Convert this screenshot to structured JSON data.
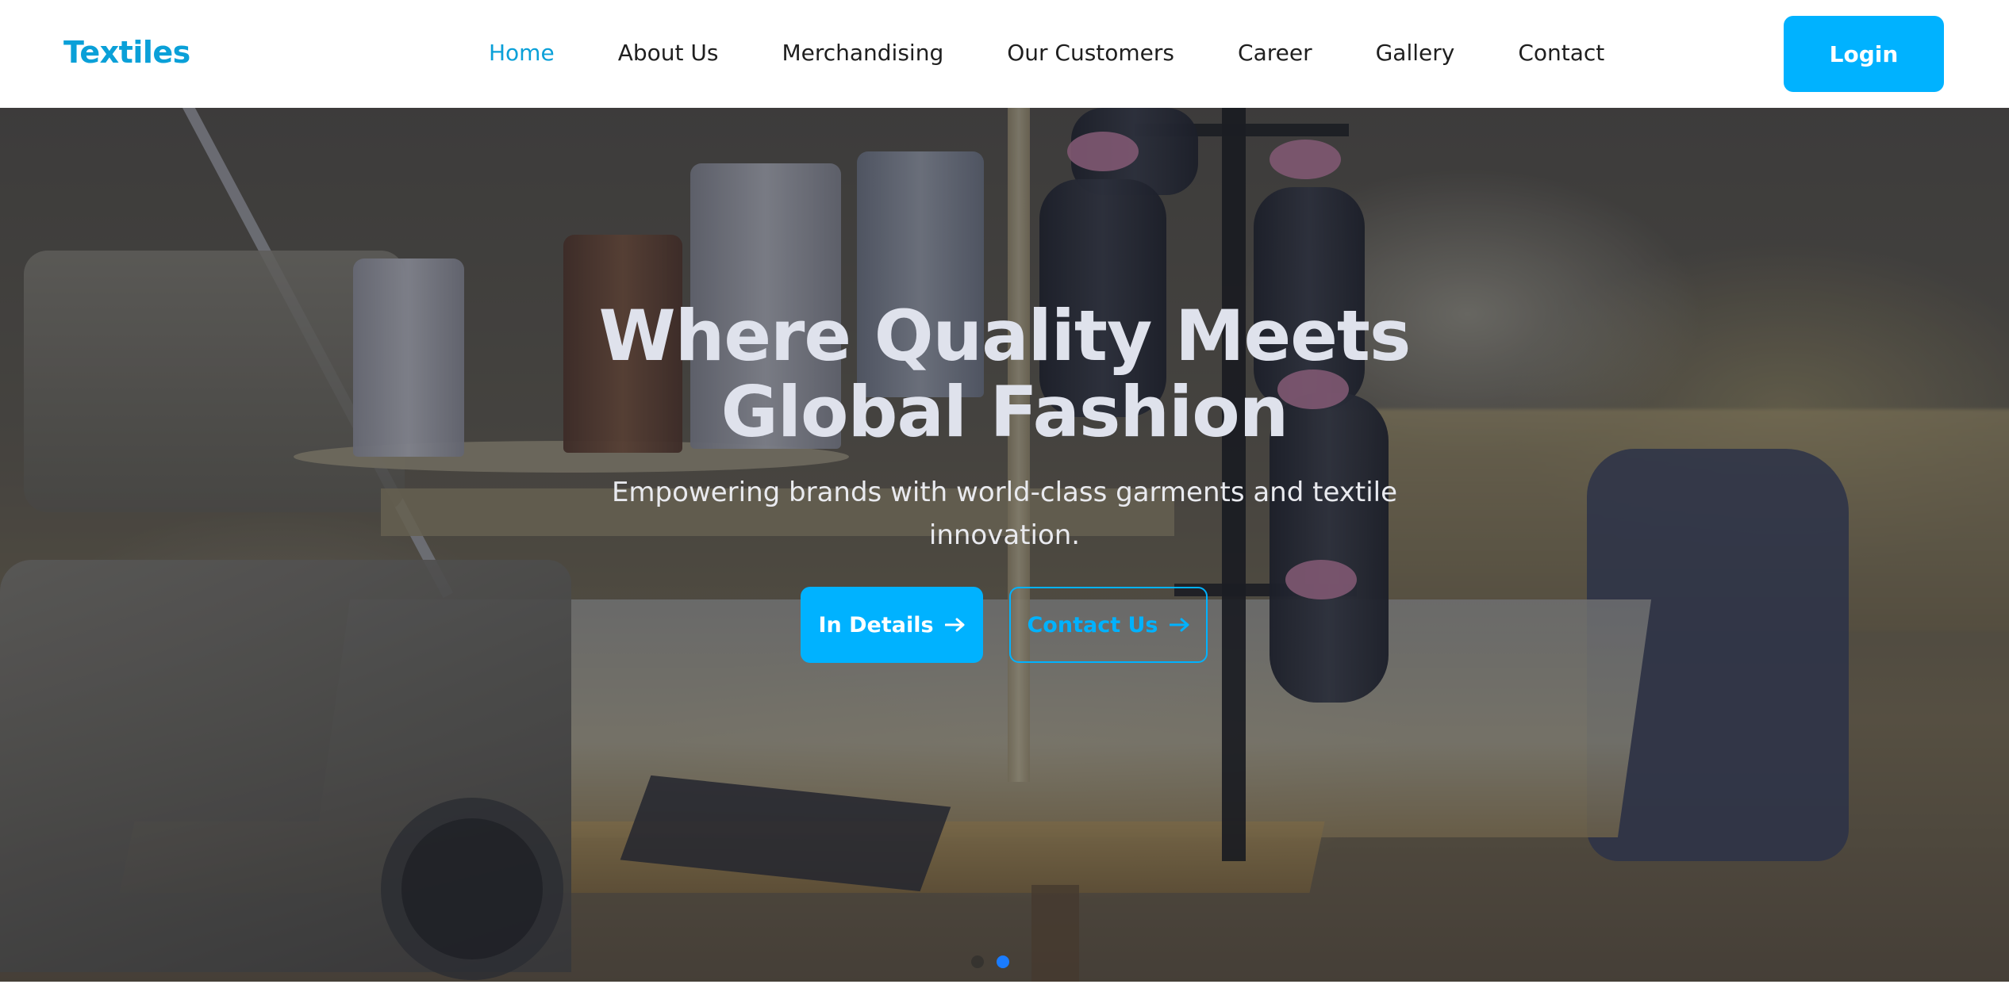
{
  "brand": {
    "name": "Textiles",
    "accent_color": "#0aa0d8",
    "button_color": "#00b2ff"
  },
  "nav": {
    "items": [
      {
        "label": "Home",
        "active": true
      },
      {
        "label": "About Us",
        "active": false
      },
      {
        "label": "Merchandising",
        "active": false
      },
      {
        "label": "Our Customers",
        "active": false
      },
      {
        "label": "Career",
        "active": false
      },
      {
        "label": "Gallery",
        "active": false
      },
      {
        "label": "Contact",
        "active": false
      }
    ],
    "login_label": "Login"
  },
  "hero": {
    "background_image": "textile factory sewing machines with thread spools",
    "title_line1": "Where Quality Meets",
    "title_line2": "Global Fashion",
    "subtitle_line1": "Empowering brands with world-class garments and textile",
    "subtitle_line2": "innovation.",
    "primary_button": {
      "label": "In Details",
      "icon": "arrow-right-icon"
    },
    "secondary_button": {
      "label": "Contact Us",
      "icon": "arrow-right-icon"
    },
    "carousel": {
      "slide_count": 2,
      "active_index": 1
    }
  }
}
